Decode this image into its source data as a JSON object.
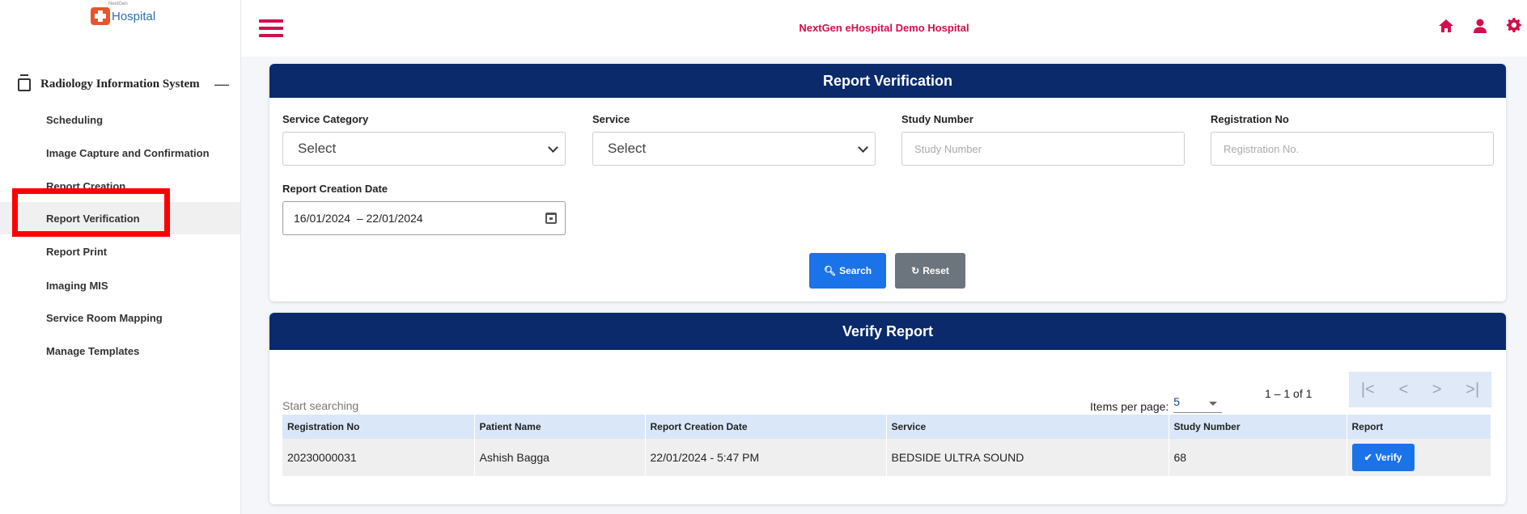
{
  "logo": {
    "brand_small": "NextGen",
    "text": "Hospital"
  },
  "sidebar": {
    "module_label": "Radiology Information System",
    "collapse_symbol": "—",
    "items": [
      {
        "label": "Scheduling"
      },
      {
        "label": "Image Capture and Confirmation"
      },
      {
        "label": "Report Creation"
      },
      {
        "label": "Report Verification",
        "active": true
      },
      {
        "label": "Report Print"
      },
      {
        "label": "Imaging MIS"
      },
      {
        "label": "Service Room Mapping"
      },
      {
        "label": "Manage Templates"
      }
    ]
  },
  "header": {
    "title": "NextGen eHospital Demo Hospital",
    "icons": [
      "home-icon",
      "user-icon",
      "gear-icon"
    ],
    "accent": "#d0104c"
  },
  "report_verification": {
    "title": "Report Verification",
    "service_category": {
      "label": "Service Category",
      "value": "Select"
    },
    "service": {
      "label": "Service",
      "value": "Select"
    },
    "study_number": {
      "label": "Study Number",
      "placeholder": "Study Number"
    },
    "registration_no": {
      "label": "Registration No",
      "placeholder": "Registration No."
    },
    "report_creation_date": {
      "label": "Report Creation Date",
      "value": "16/01/2024  – 22/01/2024"
    },
    "search_label": "Search",
    "reset_label": "Reset"
  },
  "verify_report": {
    "title": "Verify Report",
    "search_placeholder": "Start searching",
    "items_per_page_label": "Items per page:",
    "items_per_page_value": "5",
    "range": "1 – 1 of 1",
    "pager": [
      "|<",
      "<",
      ">",
      ">|"
    ],
    "columns": [
      "Registration No",
      "Patient Name",
      "Report Creation Date",
      "Service",
      "Study Number",
      "Report"
    ],
    "rows": [
      {
        "registration_no": "20230000031",
        "patient_name": "Ashish Bagga",
        "report_creation_date": "22/01/2024 - 5:47 PM",
        "service": "BEDSIDE ULTRA SOUND",
        "study_number": "68",
        "action": "Verify"
      }
    ]
  },
  "colors": {
    "header_bg": "#0a2a6b",
    "primary": "#1a73e8",
    "secondary": "#6c757d"
  }
}
